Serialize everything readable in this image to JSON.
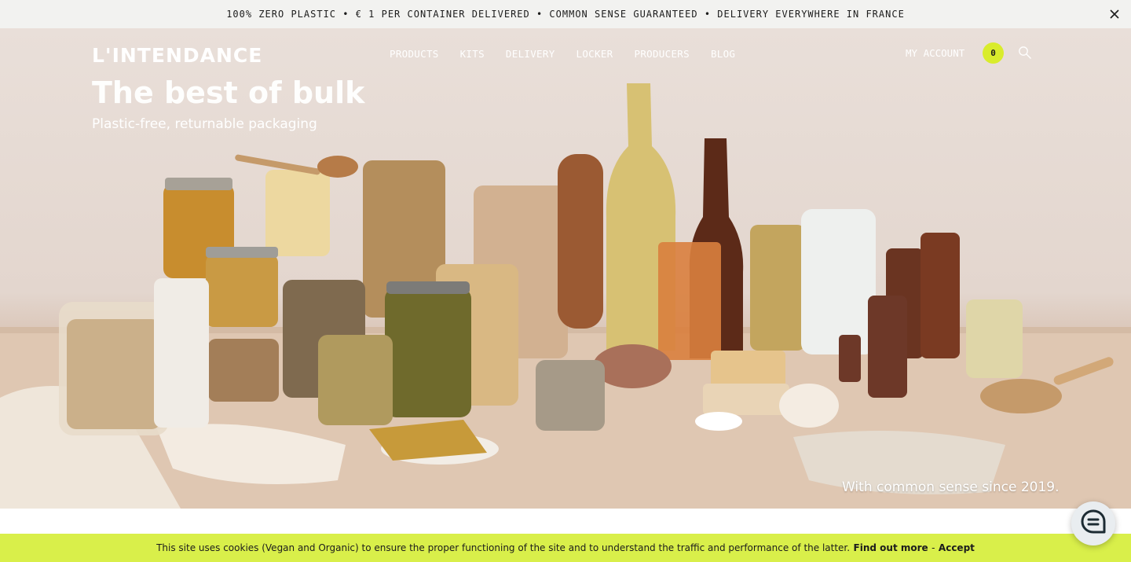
{
  "announcement": {
    "text": "100% ZERO PLASTIC • € 1 PER CONTAINER DELIVERED • COMMON SENSE GUARANTEED • DELIVERY EVERYWHERE IN FRANCE",
    "close_icon": "close-icon"
  },
  "header": {
    "logo": "L'INTENDANCE",
    "nav": [
      "PRODUCTS",
      "KITS",
      "DELIVERY",
      "LOCKER",
      "PRODUCERS",
      "BLOG"
    ],
    "account_label": "MY ACCOUNT",
    "cart_count": "0",
    "search_icon": "search-icon"
  },
  "hero": {
    "title": "The best of bulk",
    "subtitle": "Plastic-free, returnable packaging",
    "tagline": "With common sense since 2019."
  },
  "chat": {
    "icon": "chat-icon"
  },
  "cookie": {
    "text": "This site uses cookies (Vegan and Organic) to ensure the proper functioning of the site and to understand the traffic and performance of the latter.",
    "find_out_more": "Find out more",
    "separator": "-",
    "accept": "Accept"
  },
  "colors": {
    "accent": "#d9ec2c",
    "cookie_bar": "#d9ef4a",
    "announcement_bar": "#f2f2f0",
    "text_dark": "#1c1c1c"
  }
}
